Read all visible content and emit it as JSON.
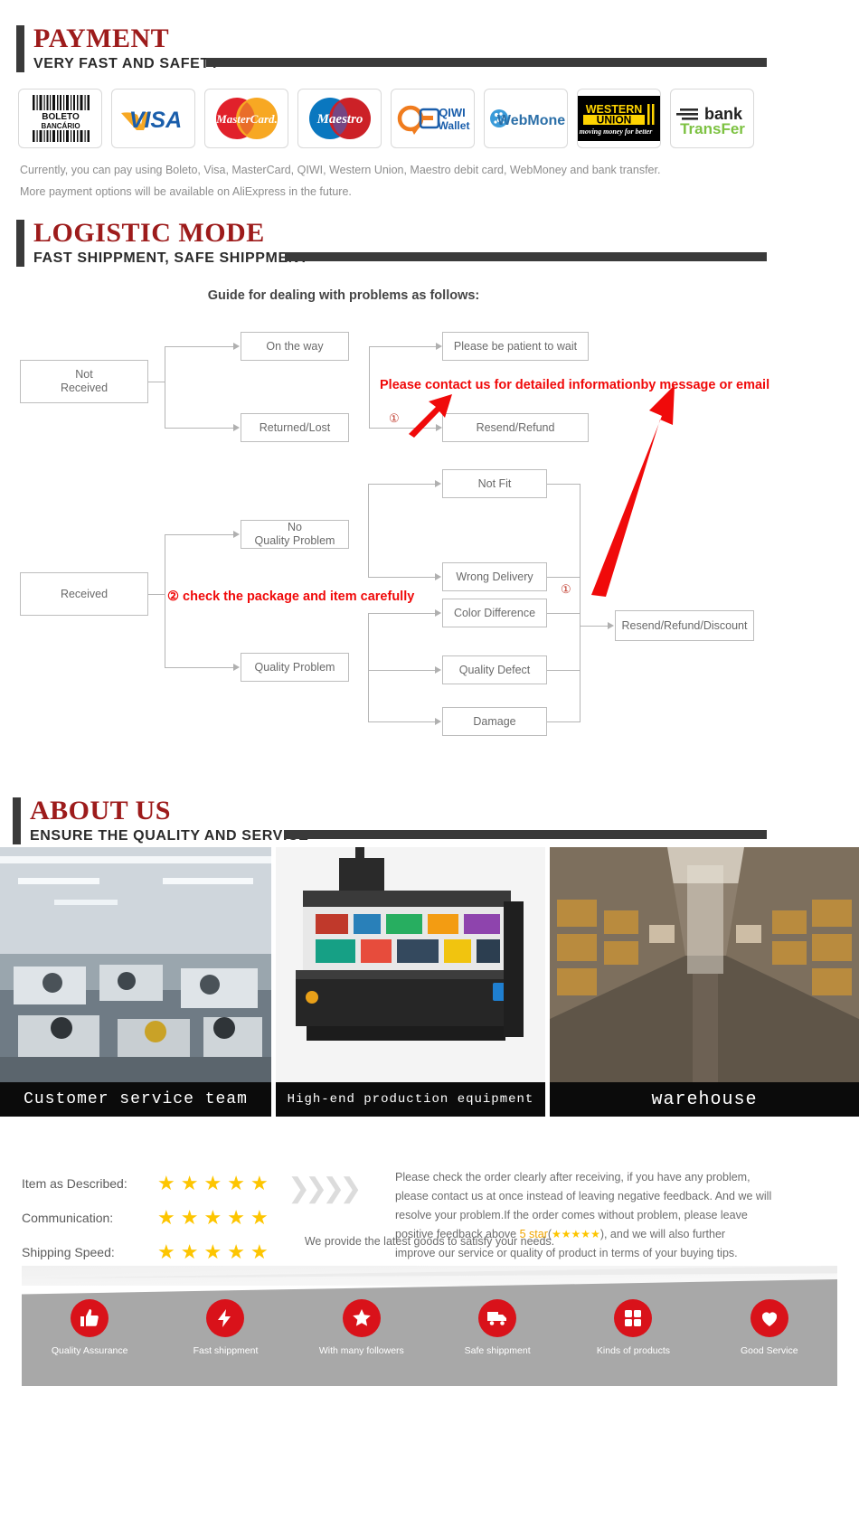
{
  "payment": {
    "title": "PAYMENT",
    "subtitle": "VERY FAST AND SAFETY",
    "methods": [
      {
        "name": "boleto-bancario-logo",
        "label": "BOLETO BANCÁRIO"
      },
      {
        "name": "visa-logo",
        "label": "VISA"
      },
      {
        "name": "mastercard-logo",
        "label": "MasterCard"
      },
      {
        "name": "maestro-logo",
        "label": "Maestro"
      },
      {
        "name": "qiwi-wallet-logo",
        "label": "QIWI Wallet"
      },
      {
        "name": "webmoney-logo",
        "label": "WebMoney"
      },
      {
        "name": "western-union-logo",
        "label": "WESTERN UNION moving money for better"
      },
      {
        "name": "bank-transfer-logo",
        "label": "bank transfer"
      }
    ],
    "note_line1": "Currently, you can pay using Boleto, Visa, MasterCard, QIWI, Western Union, Maestro debit card, WebMoney and bank transfer.",
    "note_line2": "More payment options will be available on AliExpress in the future."
  },
  "logistic": {
    "title": "LOGISTIC MODE",
    "subtitle": "FAST SHIPPMENT, SAFE SHIPPMENT",
    "flow_title": "Guide for dealing with problems as follows:",
    "boxes": {
      "not_received": "Not\nReceived",
      "on_the_way": "On the way",
      "returned_lost": "Returned/Lost",
      "please_wait": "Please be patient to wait",
      "resend_refund": "Resend/Refund",
      "received": "Received",
      "no_quality_problem": "No\nQuality Problem",
      "quality_problem": "Quality Problem",
      "not_fit": "Not Fit",
      "wrong_delivery": "Wrong Delivery",
      "color_difference": "Color Difference",
      "quality_defect": "Quality Defect",
      "damage": "Damage",
      "resend_refund_discount": "Resend/Refund/Discount"
    },
    "note_top": "Please contact us for detailed informationby message or email",
    "note_mid": "② check the package and item carefully",
    "marker_1a": "①",
    "marker_1b": "①"
  },
  "about": {
    "title": "ABOUT US",
    "subtitle": "ENSURE THE QUALITY AND SERVICE",
    "captions": [
      "Customer service team",
      "High-end production equipment",
      "warehouse"
    ]
  },
  "ratings": {
    "rows": [
      {
        "label": "Item as Described:",
        "stars": 5
      },
      {
        "label": "Communication:",
        "stars": 5
      },
      {
        "label": "Shipping Speed:",
        "stars": 5
      }
    ],
    "star_glyph": "★",
    "chevron_glyph": "❯"
  },
  "feedback": {
    "line1": "Please check the order clearly after receiving, if you have any problem,",
    "line2": "please contact us at once instead of leaving negative feedback. And we will",
    "line3": "resolve your problem.If the order comes without problem, please leave",
    "line4_pre": "positive feedback above ",
    "line4_hl": "5 star",
    "line4_paren_open": "(",
    "line4_stars": "★★★★★",
    "line4_post": "), and we will also further",
    "line5": "improve our service or quality of product in terms of your buying tips."
  },
  "tagline": "We provide the latest goods to satisfy your needs.",
  "footer": {
    "items": [
      {
        "icon": "thumbs-up-icon",
        "glyph": "👍",
        "label": "Quality Assurance"
      },
      {
        "icon": "lightning-bolt-icon",
        "glyph": "⚡",
        "label": "Fast shippment"
      },
      {
        "icon": "star-icon",
        "glyph": "★",
        "label": "With many followers"
      },
      {
        "icon": "truck-icon",
        "glyph": "🚚",
        "label": "Safe shippment"
      },
      {
        "icon": "grid-products-icon",
        "glyph": "▦",
        "label": "Kinds of products"
      },
      {
        "icon": "heart-icon",
        "glyph": "♥",
        "label": "Good Service"
      }
    ],
    "accent_color": "#d9121a",
    "band_color": "#a8a8a8"
  },
  "colors": {
    "heading_red": "#9d1b1b",
    "note_red": "#f00a0a",
    "star_yellow": "#fdc500",
    "bar_dark": "#3a3a3a"
  }
}
